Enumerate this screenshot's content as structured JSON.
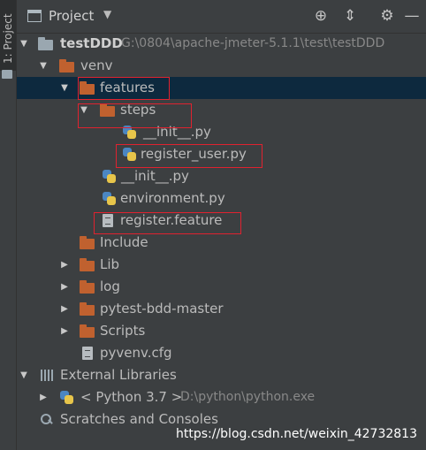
{
  "side_stripe": {
    "label": "1: Project"
  },
  "header": {
    "title": "Project",
    "caret": "▼",
    "locate_icon": "⊕",
    "collapse_icon": "⇕",
    "settings_icon": "⚙",
    "hide_icon": "—"
  },
  "tree": {
    "root": {
      "name": "testDDD",
      "path": "G:\\0804\\apache-jmeter-5.1.1\\test\\testDDD"
    },
    "venv": "venv",
    "features": "features",
    "steps": "steps",
    "steps_init": "__init__.py",
    "register_user": "register_user.py",
    "features_init": "__init__.py",
    "environment": "environment.py",
    "register_feature": "register.feature",
    "include": "Include",
    "lib": "Lib",
    "log": "log",
    "pytest_bdd": "pytest-bdd-master",
    "scripts": "Scripts",
    "pyvenv": "pyvenv.cfg",
    "external_libraries": "External Libraries",
    "python_sdk": {
      "name": "< Python 3.7 >",
      "path": "D:\\python\\python.exe"
    },
    "scratches": "Scratches and Consoles"
  },
  "watermark": "https://blog.csdn.net/weixin_42732813",
  "colors": {
    "background": "#3c3f41",
    "selection": "#0d293e",
    "folder": "#c0612f",
    "highlight_box": "#e0222f"
  }
}
